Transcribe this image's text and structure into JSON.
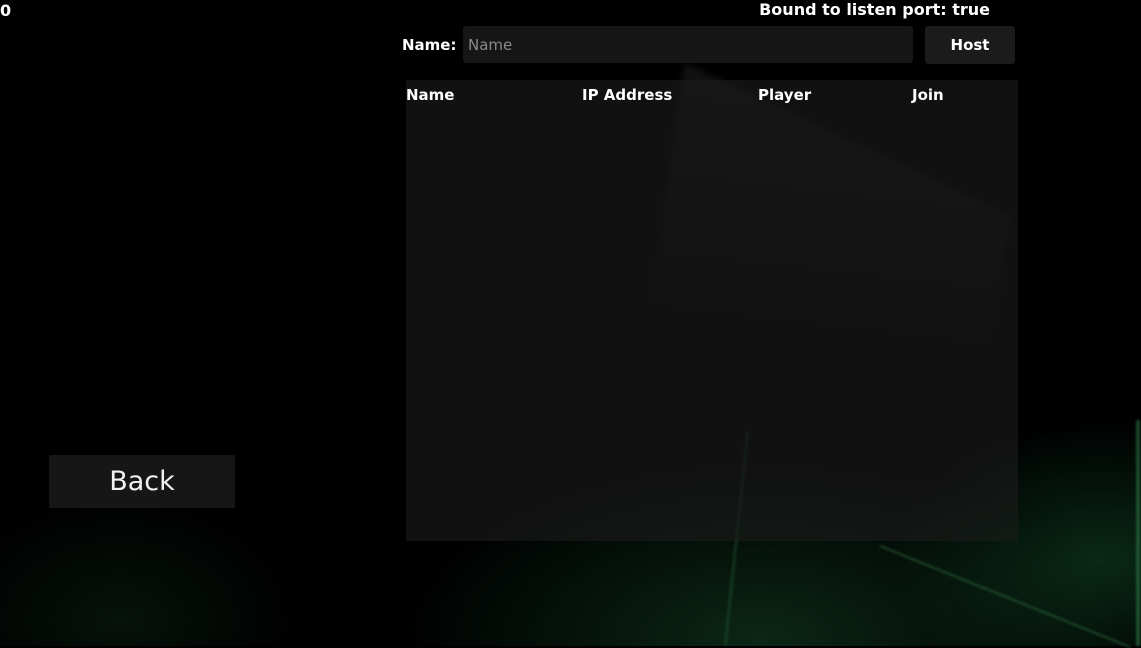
{
  "hud": {
    "counter": "0",
    "port_status": "Bound to listen port: true"
  },
  "host_form": {
    "name_label": "Name:",
    "name_value": "",
    "name_placeholder": "Name",
    "host_button_label": "Host"
  },
  "server_list": {
    "columns": [
      "Name",
      "IP Address",
      "Player",
      "Join"
    ],
    "rows": []
  },
  "navigation": {
    "back_button_label": "Back"
  }
}
